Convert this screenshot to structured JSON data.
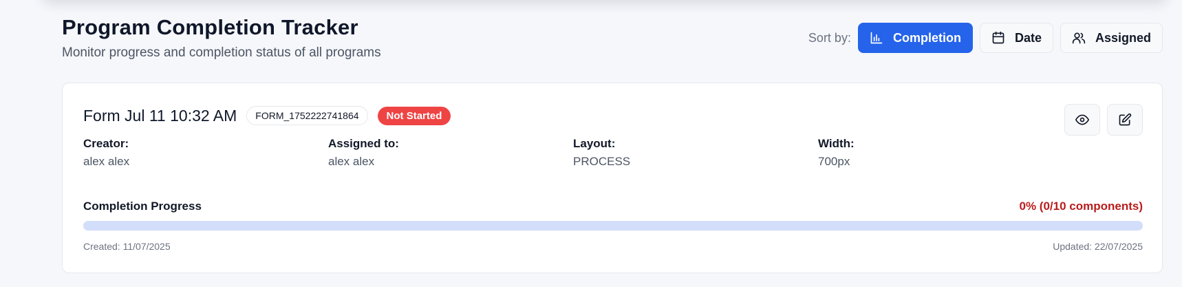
{
  "header": {
    "title": "Program Completion Tracker",
    "subtitle": "Monitor progress and completion status of all programs"
  },
  "sort": {
    "label": "Sort by:",
    "options": [
      {
        "label": "Completion",
        "icon": "bar-chart-icon",
        "active": true
      },
      {
        "label": "Date",
        "icon": "calendar-icon",
        "active": false
      },
      {
        "label": "Assigned",
        "icon": "users-icon",
        "active": false
      }
    ]
  },
  "card": {
    "name": "Form Jul 11 10:32 AM",
    "form_id": "FORM_1752222741864",
    "status": "Not Started",
    "status_color": "#ef4444",
    "meta": {
      "creator_label": "Creator:",
      "creator_value": "alex alex",
      "assigned_label": "Assigned to:",
      "assigned_value": "alex alex",
      "layout_label": "Layout:",
      "layout_value": "PROCESS",
      "width_label": "Width:",
      "width_value": "700px"
    },
    "progress": {
      "title": "Completion Progress",
      "value_text": "0% (0/10 components)",
      "percent": 0,
      "value_color": "#b91c1c"
    },
    "created": "Created: 11/07/2025",
    "updated": "Updated: 22/07/2025",
    "actions": [
      {
        "icon": "eye-icon"
      },
      {
        "icon": "edit-icon"
      }
    ]
  },
  "colors": {
    "accent": "#2563eb",
    "track": "#d3defa",
    "background": "#f6f7fb"
  }
}
